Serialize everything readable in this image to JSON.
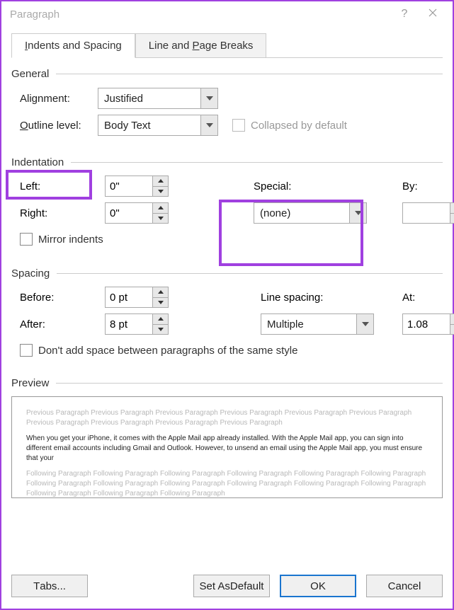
{
  "title": "Paragraph",
  "tabs": {
    "indents": "Indents and Spacing",
    "breaks": "Line and Page Breaks"
  },
  "general": {
    "title": "General",
    "alignment_lbl": "Alignment:",
    "alignment_val": "Justified",
    "outline_lbl": "Outline level:",
    "outline_val": "Body Text",
    "collapsed": "Collapsed by default"
  },
  "indent": {
    "title": "Indentation",
    "left_lbl": "Left:",
    "left_val": "0\"",
    "right_lbl": "Right:",
    "right_val": "0\"",
    "special_lbl": "Special:",
    "special_val": "(none)",
    "by_lbl": "By:",
    "by_val": "",
    "mirror": "Mirror indents"
  },
  "spacing": {
    "title": "Spacing",
    "before_lbl": "Before:",
    "before_val": "0 pt",
    "after_lbl": "After:",
    "after_val": "8 pt",
    "line_lbl": "Line spacing:",
    "line_val": "Multiple",
    "at_lbl": "At:",
    "at_val": "1.08",
    "no_space": "Don't add space between paragraphs of the same style"
  },
  "preview": {
    "title": "Preview",
    "prev": "Previous Paragraph Previous Paragraph Previous Paragraph Previous Paragraph Previous Paragraph Previous Paragraph Previous Paragraph Previous Paragraph Previous Paragraph Previous Paragraph",
    "body": "When you get your iPhone, it comes with the Apple Mail app already installed. With the Apple Mail app, you can sign into different email accounts including Gmail and Outlook. However, to unsend an email using the Apple Mail app, you must ensure that your",
    "next": "Following Paragraph Following Paragraph Following Paragraph Following Paragraph Following Paragraph Following Paragraph Following Paragraph Following Paragraph Following Paragraph Following Paragraph Following Paragraph Following Paragraph Following Paragraph Following Paragraph Following Paragraph"
  },
  "buttons": {
    "tabs": "Tabs...",
    "default": "Set As Default",
    "ok": "OK",
    "cancel": "Cancel"
  }
}
